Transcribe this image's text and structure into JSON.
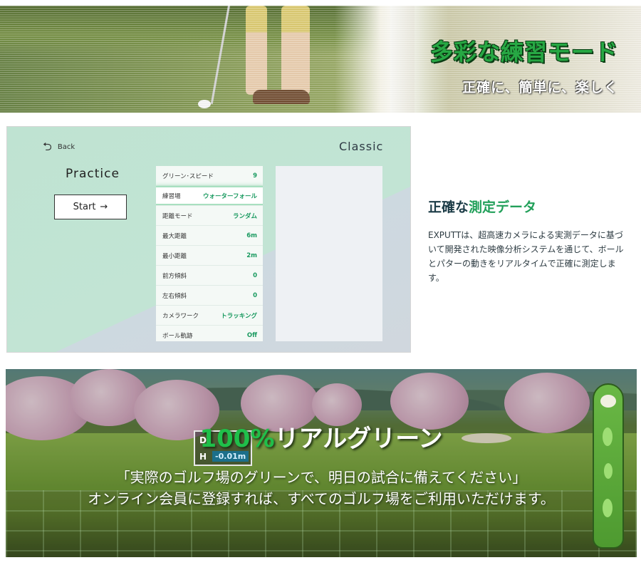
{
  "hero": {
    "title": "多彩な練習モード",
    "subtitle": "正確に、簡単に、楽しく"
  },
  "app": {
    "back_label": "Back",
    "mode_title": "Practice",
    "start_label": "Start",
    "start_icon": "arrow-right-icon",
    "classic_label": "Classic",
    "settings": [
      {
        "label": "グリーン･スピード",
        "value": "9"
      },
      {
        "label": "練習場",
        "value": "ウォーターフォール",
        "selected": true
      },
      {
        "label": "距離モード",
        "value": "ランダム"
      },
      {
        "label": "最大距離",
        "value": "6m"
      },
      {
        "label": "最小距離",
        "value": "2m"
      },
      {
        "label": "前方傾斜",
        "value": "0"
      },
      {
        "label": "左右傾斜",
        "value": "0"
      },
      {
        "label": "カメラワーク",
        "value": "トラッキング"
      },
      {
        "label": "ボール軌跡",
        "value": "Off"
      }
    ],
    "accent_color": "#1a9a60"
  },
  "measure": {
    "title_plain": "正確な",
    "title_accent": "測定データ",
    "body": "EXPUTTは、超高速カメラによる実測データに基づいて開発された映像分析システムを通じて、ボールとパターの動きをリアルタイムで正確に測定します。"
  },
  "green": {
    "title_accent": "100%",
    "title_rest": "リアルグリーン",
    "line1": "「実際のゴルフ場のグリーンで、明日の試合に備えてください」",
    "line2": "オンライン会員に登録すれば、すべてのゴルフ場をご利用いただけます。",
    "hud": {
      "d_key": "D",
      "h_key": "H",
      "h_value": "-0.01m"
    }
  }
}
